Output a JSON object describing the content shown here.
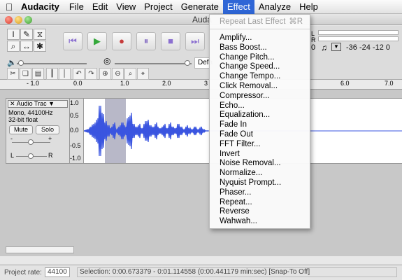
{
  "menubar": {
    "apple_icon": "apple-icon",
    "app_name": "Audacity",
    "items": [
      "File",
      "Edit",
      "View",
      "Project",
      "Generate",
      "Effect",
      "Analyze",
      "Help"
    ],
    "active_item": "Effect"
  },
  "window": {
    "title": "Auda"
  },
  "toolbar": {
    "tools": [
      "I",
      "✎",
      "⌕",
      "↔",
      "✱",
      "⧖"
    ],
    "transport": [
      "⏮",
      "▶",
      "●",
      "⏸",
      "■",
      "⏭"
    ],
    "meter_left_label": "L",
    "meter_right_label": "R",
    "meter_scale": "-36 -24 -12 0",
    "meter_partial": "0",
    "device_label": "Defa"
  },
  "ruler": {
    "ticks": [
      "- 1.0",
      "0.0",
      "1.0",
      "2.0",
      "3",
      "6.0",
      "7.0"
    ]
  },
  "track": {
    "name": "Audio Trac",
    "format_line1": "Mono, 44100Hz",
    "format_line2": "32-bit float",
    "mute_label": "Mute",
    "solo_label": "Solo",
    "gain_left": "-",
    "gain_right": "+",
    "pan_left": "L",
    "pan_right": "R",
    "scale": [
      "1.0",
      "0.5",
      "0.0",
      "-0.5",
      "-1.0"
    ]
  },
  "effect_menu": {
    "repeat_label": "Repeat Last Effect",
    "repeat_shortcut": "⌘R",
    "items": [
      "Amplify...",
      "Bass Boost...",
      "Change Pitch...",
      "Change Speed...",
      "Change Tempo...",
      "Click Removal...",
      "Compressor...",
      "Echo...",
      "Equalization...",
      "Fade In",
      "Fade Out",
      "FFT Filter...",
      "Invert",
      "Noise Removal...",
      "Normalize...",
      "Nyquist Prompt...",
      "Phaser...",
      "Repeat...",
      "Reverse",
      "Wahwah..."
    ]
  },
  "status": {
    "rate_label": "Project rate:",
    "rate_value": "44100",
    "selection_text": "Selection: 0:00.673379 - 0:01.114558 (0:00.441179 min:sec)  [Snap-To Off]"
  },
  "colors": {
    "waveform": "#3a55e0",
    "selection": "#b8b8c8",
    "menu_highlight": "#2f66d6"
  }
}
